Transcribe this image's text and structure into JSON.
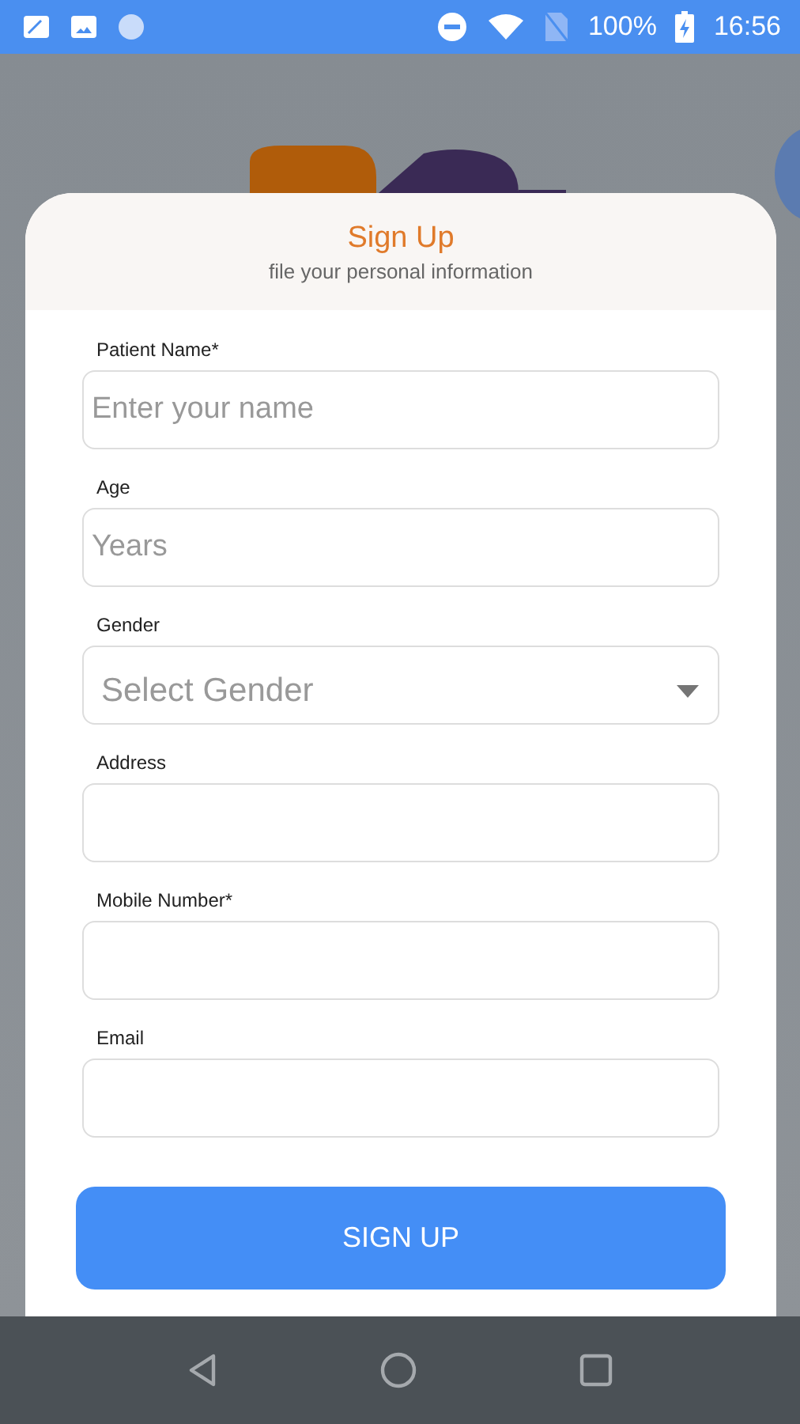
{
  "status_bar": {
    "battery": "100%",
    "time": "16:56"
  },
  "form": {
    "title": "Sign Up",
    "subtitle": "file your personal information",
    "fields": [
      {
        "kind": "text",
        "label": "Patient Name*",
        "placeholder": "Enter your name"
      },
      {
        "kind": "text",
        "label": "Age",
        "placeholder": "Years"
      },
      {
        "kind": "select",
        "label": "Gender",
        "placeholder": "Select Gender"
      },
      {
        "kind": "text",
        "label": "Address"
      },
      {
        "kind": "text",
        "label": "Mobile Number*"
      },
      {
        "kind": "text",
        "label": "Email"
      }
    ],
    "submit": "SIGN UP"
  }
}
